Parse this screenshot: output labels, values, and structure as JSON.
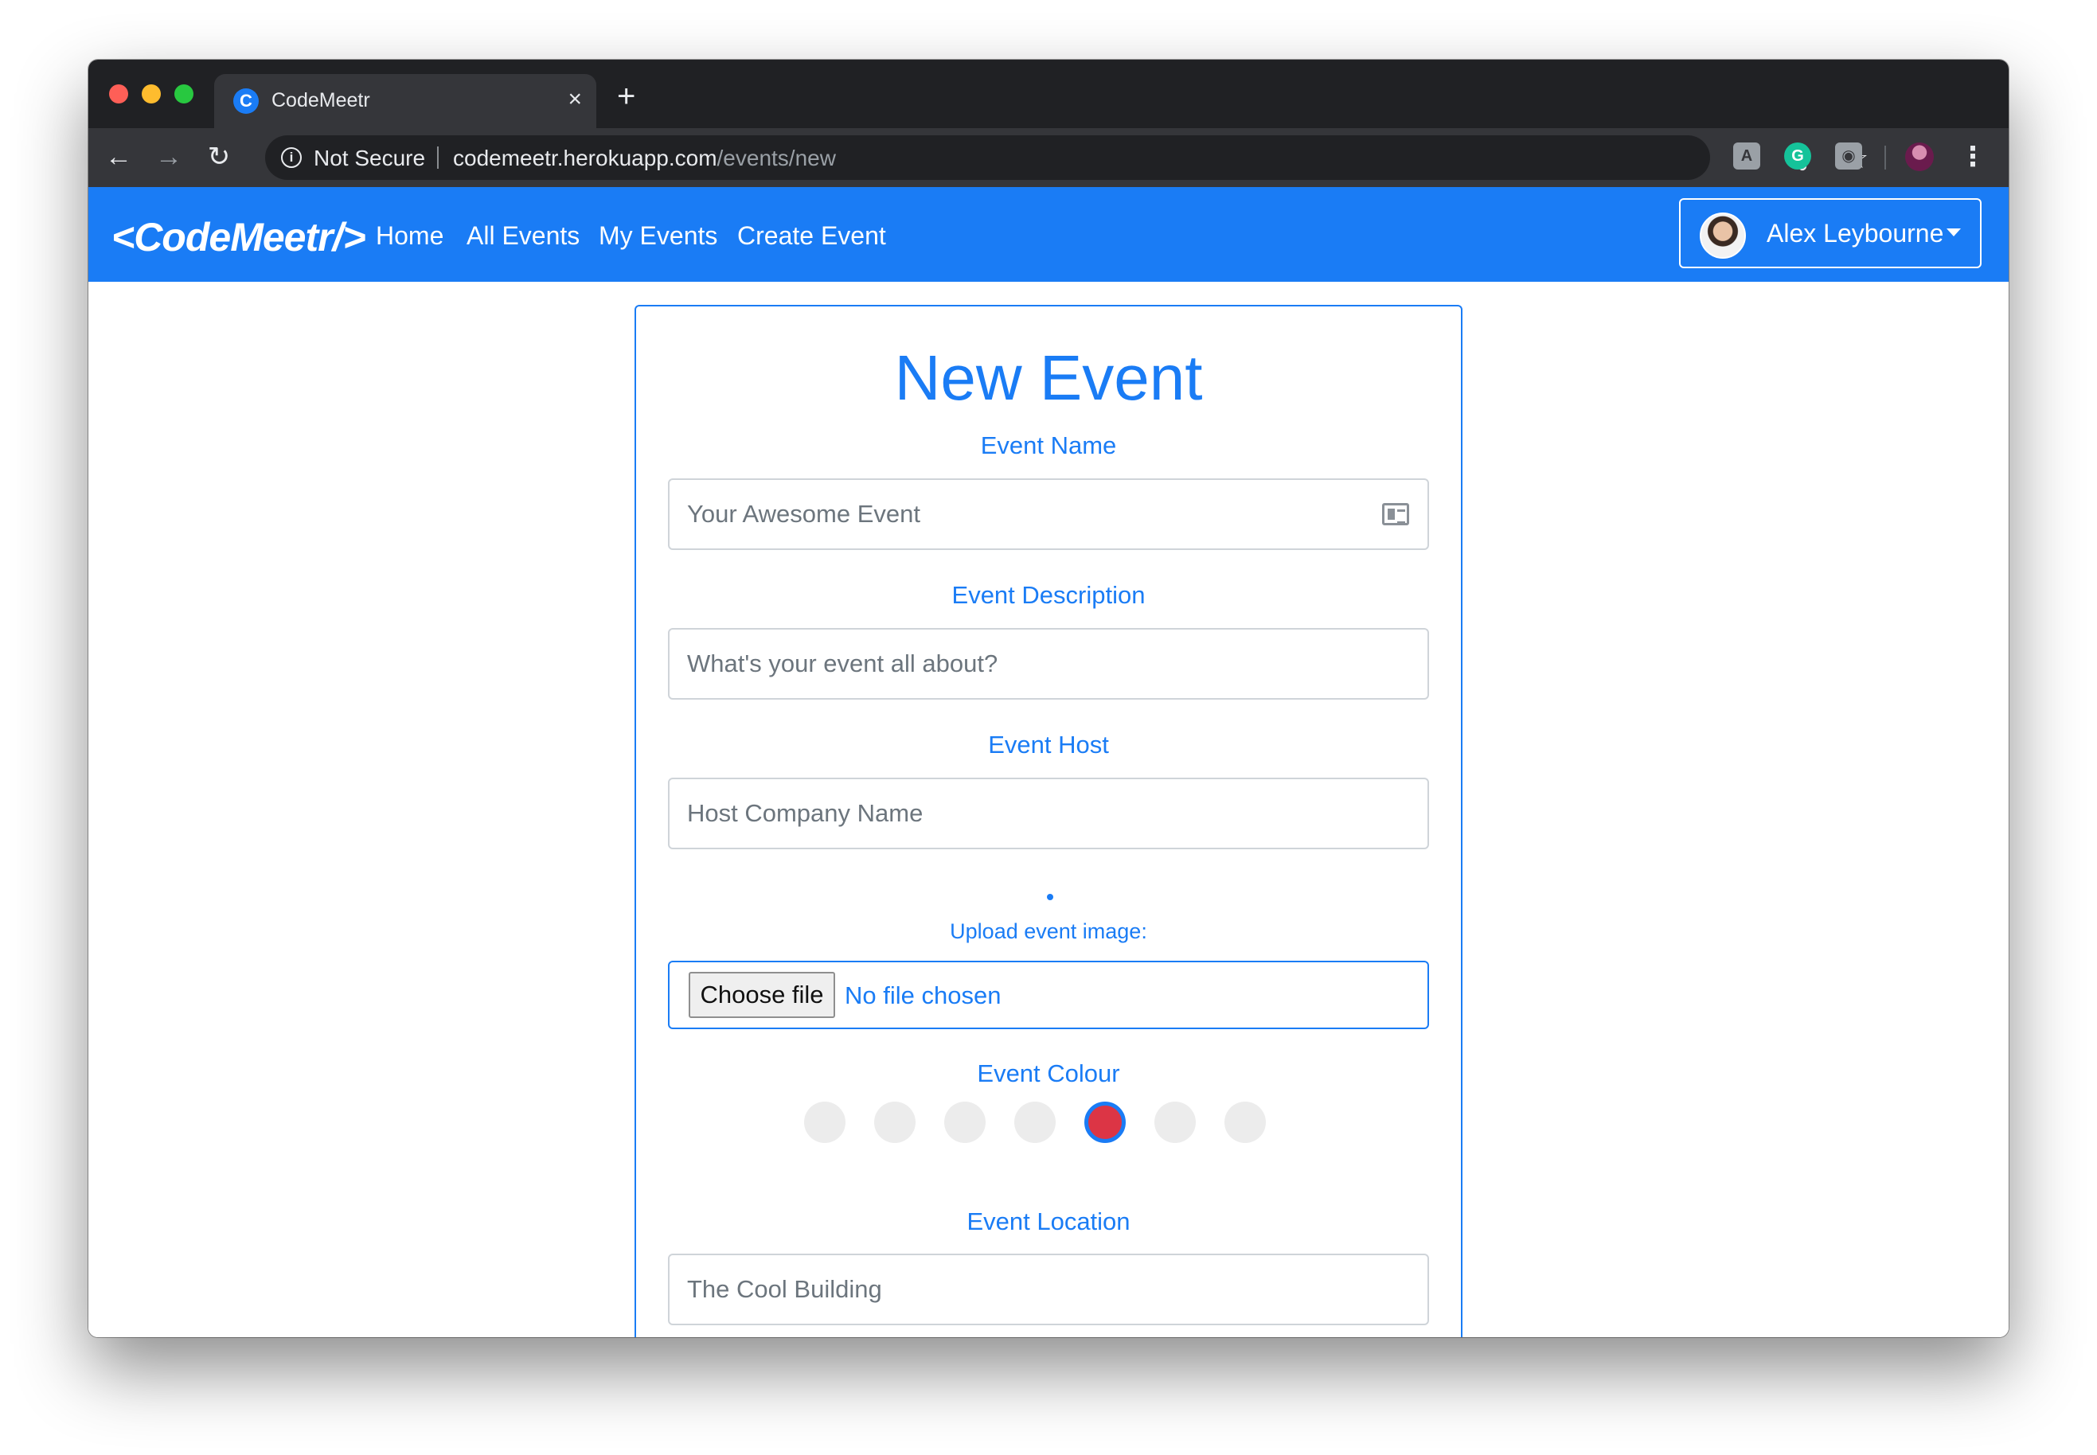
{
  "browser": {
    "tab_title": "CodeMeetr",
    "tab_close": "×",
    "new_tab": "+",
    "security_label": "Not Secure",
    "url_host": "codemeetr.herokuapp.com",
    "url_path": "/events/new",
    "back_glyph": "←",
    "forward_glyph": "→",
    "reload_glyph": "↻",
    "info_glyph": "i",
    "key_glyph": "⚷",
    "star_glyph": "☆",
    "menu_glyph": "⋮"
  },
  "navbar": {
    "brand": "<CodeMeetr/>",
    "links": [
      {
        "label": "Home"
      },
      {
        "label": "All Events"
      },
      {
        "label": "My Events"
      },
      {
        "label": "Create Event"
      }
    ],
    "user_name": "Alex Leybourne"
  },
  "form": {
    "title": "New Event",
    "event_name": {
      "label": "Event Name",
      "placeholder": "Your Awesome Event"
    },
    "event_description": {
      "label": "Event Description",
      "placeholder": "What's your event all about?"
    },
    "event_host": {
      "label": "Event Host",
      "placeholder": "Host Company Name"
    },
    "image_upload": {
      "label": "Upload event image:",
      "button": "Choose file",
      "status": "No file chosen"
    },
    "event_colour": {
      "label": "Event Colour",
      "selected_index": 4,
      "selected_color": "#dc3545",
      "unselected_color": "#ececec"
    },
    "event_location": {
      "label": "Event Location",
      "placeholder": "The Cool Building"
    }
  },
  "theme": {
    "primary": "#1a7cf5",
    "browser_frame": "#202124",
    "browser_toolbar": "#35363a"
  }
}
